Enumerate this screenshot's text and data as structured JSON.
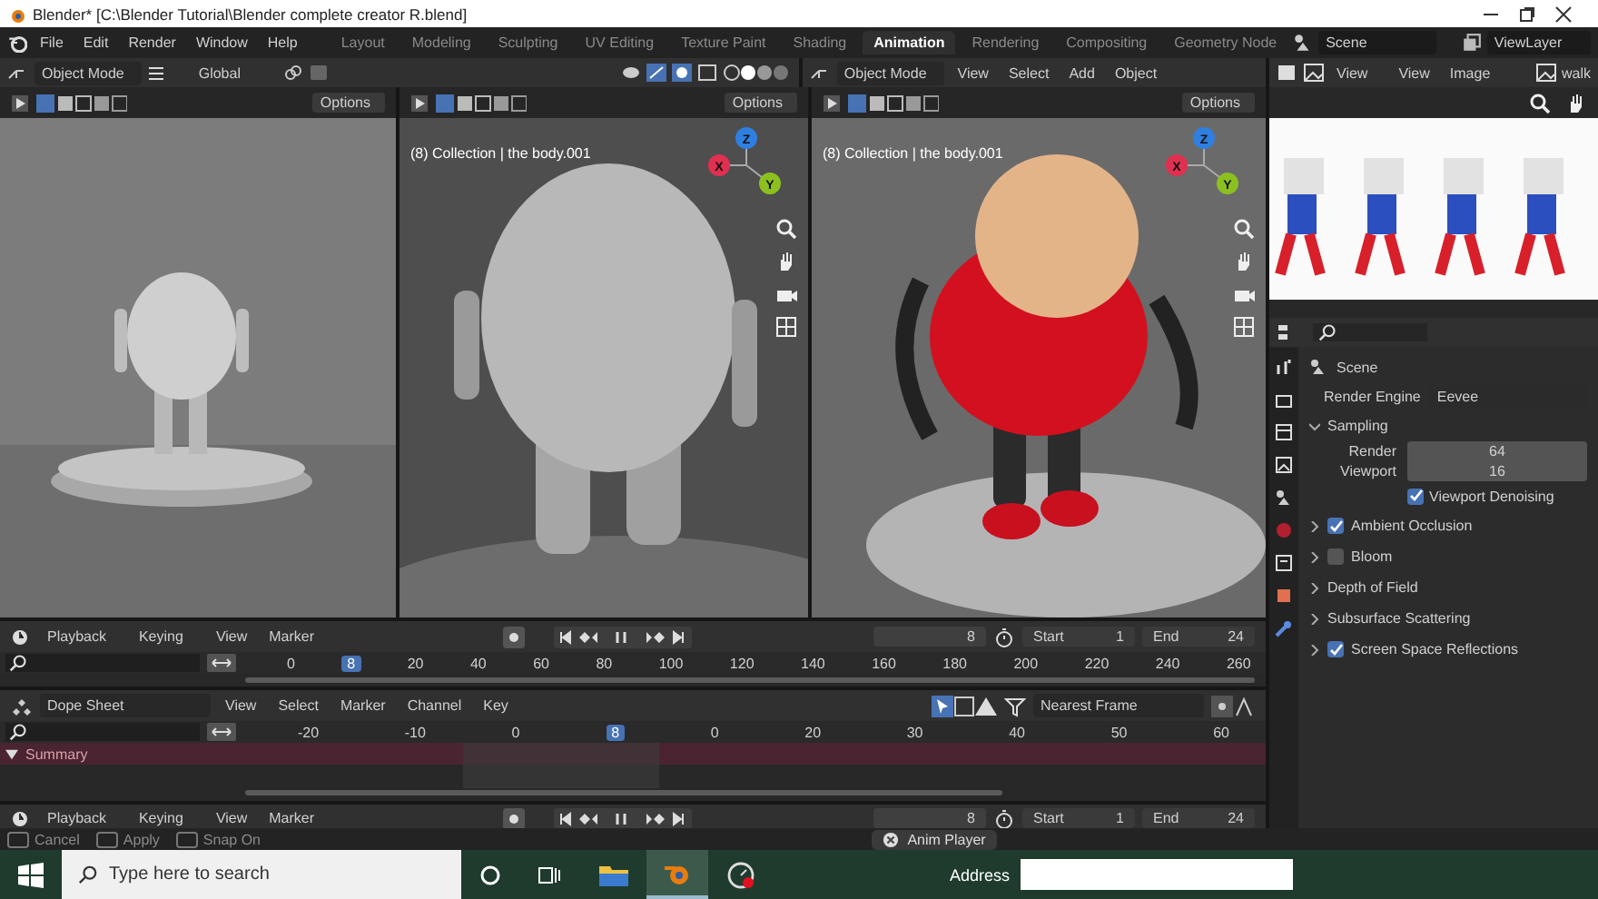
{
  "title_bar": {
    "title": "Blender* [C:\\Blender Tutorial\\Blender complete creator R.blend]"
  },
  "top_bar": {
    "menus": [
      "File",
      "Edit",
      "Render",
      "Window",
      "Help"
    ],
    "workspaces": [
      {
        "label": "Layout",
        "selected": false
      },
      {
        "label": "Modeling",
        "selected": false
      },
      {
        "label": "Sculpting",
        "selected": false
      },
      {
        "label": "UV Editing",
        "selected": false
      },
      {
        "label": "Texture Paint",
        "selected": false
      },
      {
        "label": "Shading",
        "selected": false
      },
      {
        "label": "Animation",
        "selected": true
      },
      {
        "label": "Rendering",
        "selected": false
      },
      {
        "label": "Compositing",
        "selected": false
      },
      {
        "label": "Geometry Node",
        "selected": false
      }
    ],
    "scene": "Scene",
    "view_layer": "ViewLayer"
  },
  "viewport_header": {
    "left": {
      "mode": "Object Mode",
      "orientation": "Global"
    },
    "right": {
      "mode": "Object Mode",
      "menus": [
        "View",
        "Select",
        "Add",
        "Object"
      ]
    }
  },
  "viewports": [
    {
      "options": "Options"
    },
    {
      "options": "Options",
      "overlay": "(8) Collection | the body.001",
      "gizmo": [
        "Z",
        "X",
        "Y"
      ]
    },
    {
      "options": "Options",
      "overlay": "(8) Collection | the body.001",
      "gizmo": [
        "Z",
        "X",
        "Y"
      ]
    }
  ],
  "image_editor": {
    "view_menu": "View",
    "menus": [
      "View",
      "Image"
    ],
    "image": "walk"
  },
  "properties": {
    "context": "Scene",
    "engine_label": "Render Engine",
    "engine": "Eevee",
    "sections": [
      {
        "kind": "fields",
        "label": "Sampling",
        "expanded": true,
        "fields": [
          {
            "label": "Render",
            "value": "64"
          },
          {
            "label": "Viewport",
            "value": "16"
          }
        ],
        "option": {
          "label": "Viewport Denoising",
          "checked": true
        }
      },
      {
        "kind": "toggle",
        "label": "Ambient Occlusion",
        "expanded": false,
        "checked": true
      },
      {
        "kind": "toggle",
        "label": "Bloom",
        "expanded": false,
        "checked": false
      },
      {
        "kind": "plain",
        "label": "Depth of Field",
        "expanded": false
      },
      {
        "kind": "plain",
        "label": "Subsurface Scattering",
        "expanded": false
      },
      {
        "kind": "toggle",
        "label": "Screen Space Reflections",
        "expanded": false,
        "checked": true
      }
    ]
  },
  "timeline": {
    "menus": [
      "Playback",
      "Keying",
      "View",
      "Marker"
    ],
    "frame": "8",
    "start_label": "Start",
    "start": "1",
    "end_label": "End",
    "end": "24",
    "ticks": [
      "0",
      "20",
      "40",
      "60",
      "80",
      "100",
      "120",
      "140",
      "160",
      "180",
      "200",
      "220",
      "240",
      "260"
    ],
    "current_frame": "8"
  },
  "dope_sheet": {
    "mode": "Dope Sheet",
    "menus": [
      "View",
      "Select",
      "Marker",
      "Channel",
      "Key"
    ],
    "snap": "Nearest Frame",
    "ticks": [
      "-20",
      "-10",
      "0",
      "0",
      "20",
      "30",
      "40",
      "50",
      "60"
    ],
    "current_frame": "8",
    "channels": [
      {
        "label": "Summary",
        "expanded": true
      }
    ]
  },
  "timeline_bottom": {
    "menus": [
      "Playback",
      "Keying",
      "View",
      "Marker"
    ],
    "frame": "8",
    "start_label": "Start",
    "start": "1",
    "end_label": "End",
    "end": "24"
  },
  "status_bar": {
    "hints": [
      "Cancel",
      "Apply",
      "Snap On"
    ],
    "mode": "Anim Player"
  },
  "taskbar": {
    "search_placeholder": "Type here to search",
    "address_label": "Address"
  }
}
